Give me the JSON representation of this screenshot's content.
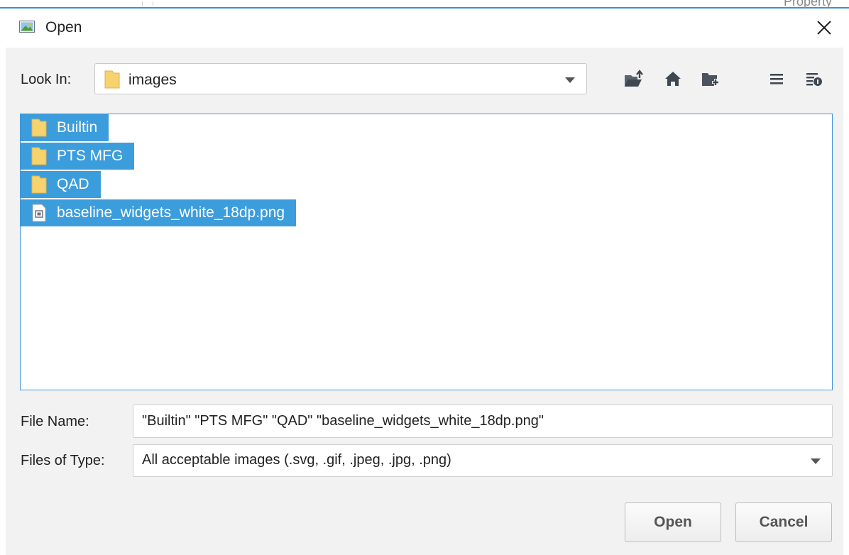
{
  "window": {
    "title": "Open",
    "close_glyph": "×"
  },
  "background_window": {
    "partial_text": "Property"
  },
  "look_in": {
    "label": "Look In:",
    "value": "images"
  },
  "toolbar": {
    "icons": [
      "up-one-level-icon",
      "home-icon",
      "new-folder-icon",
      "list-view-icon",
      "details-view-icon"
    ]
  },
  "file_list": {
    "items": [
      {
        "name": "Builtin",
        "type": "folder",
        "selected": true
      },
      {
        "name": "PTS MFG",
        "type": "folder",
        "selected": true
      },
      {
        "name": "QAD",
        "type": "folder",
        "selected": true
      },
      {
        "name": "baseline_widgets_white_18dp.png",
        "type": "image-file",
        "selected": true
      }
    ]
  },
  "file_name": {
    "label": "File Name:",
    "value": "\"Builtin\" \"PTS MFG\" \"QAD\" \"baseline_widgets_white_18dp.png\""
  },
  "files_of_type": {
    "label": "Files of Type:",
    "value": "All acceptable images (.svg, .gif, .jpeg, .jpg, .png)"
  },
  "buttons": {
    "open": "Open",
    "cancel": "Cancel"
  },
  "colors": {
    "selection": "#3c9ddd",
    "dialog_bg": "#f2f2f2",
    "folder": "#f6d36e",
    "accent_border": "#3d94d9"
  }
}
